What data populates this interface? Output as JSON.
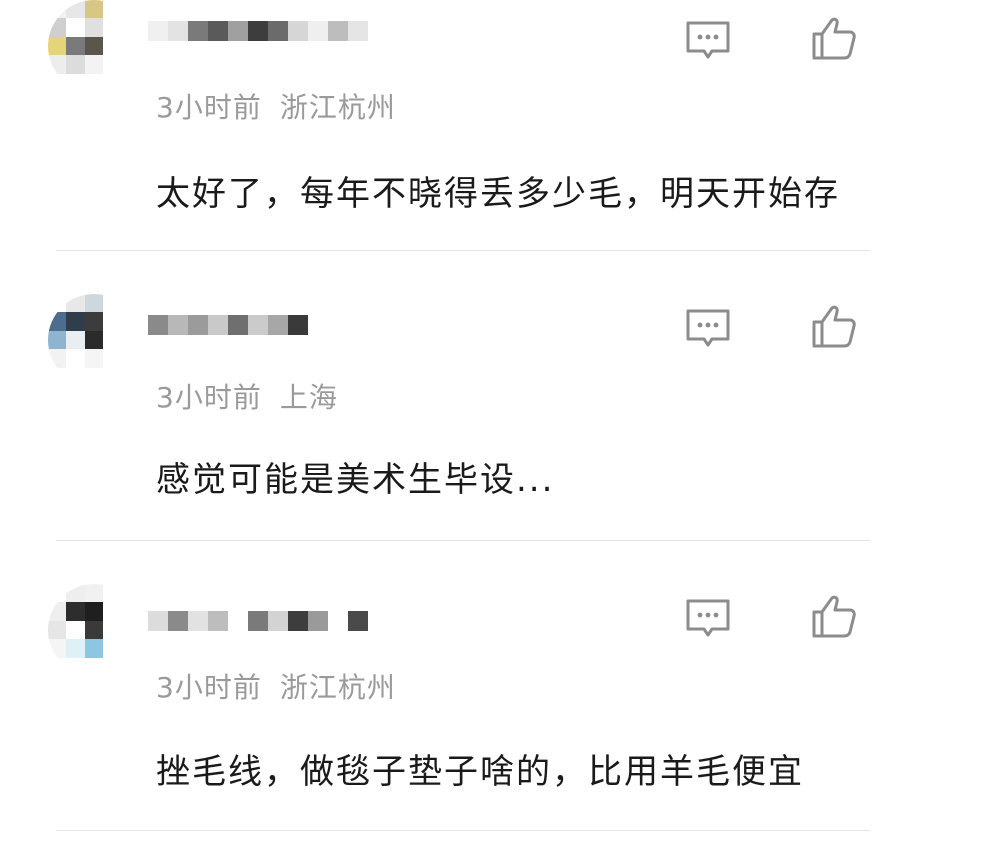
{
  "comments": [
    {
      "time": "3小时前",
      "location": "浙江杭州",
      "text": "太好了，每年不晓得丢多少毛，明天开始存",
      "reply_icon": "comment-bubble-icon",
      "like_icon": "thumbs-up-icon"
    },
    {
      "time": "3小时前",
      "location": "上海",
      "text": "感觉可能是美术生毕设...",
      "reply_icon": "comment-bubble-icon",
      "like_icon": "thumbs-up-icon"
    },
    {
      "time": "3小时前",
      "location": "浙江杭州",
      "text": "挫毛线，做毯子垫子啥的，比用羊毛便宜",
      "reply_icon": "comment-bubble-icon",
      "like_icon": "thumbs-up-icon"
    }
  ],
  "colors": {
    "meta_gray": "#9a9a9a",
    "text_dark": "#1a1a1a",
    "icon_gray": "#8c8c8c",
    "divider": "#e6e6e6"
  }
}
